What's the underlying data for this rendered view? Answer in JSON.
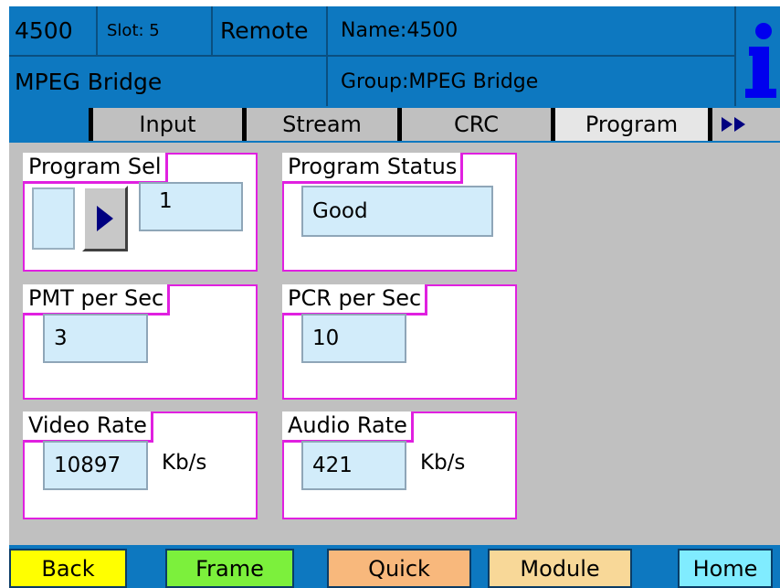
{
  "header": {
    "model": "4500",
    "slot": "Slot: 5",
    "mode": "Remote",
    "name": "Name:4500",
    "product": "MPEG Bridge",
    "group": "Group:MPEG Bridge",
    "info_icon": "info-icon"
  },
  "tabs": {
    "input": "Input",
    "stream": "Stream",
    "crc": "CRC",
    "program": "Program",
    "more_icon": "double-right-arrow-icon"
  },
  "panels": {
    "program_sel": {
      "title": "Program Sel",
      "value": "1"
    },
    "program_status": {
      "title": "Program Status",
      "value": "Good"
    },
    "pmt_per_sec": {
      "title": "PMT per Sec",
      "value": "3"
    },
    "pcr_per_sec": {
      "title": "PCR per Sec",
      "value": "10"
    },
    "video_rate": {
      "title": "Video Rate",
      "value": "10897",
      "unit": "Kb/s"
    },
    "audio_rate": {
      "title": "Audio Rate",
      "value": "421",
      "unit": "Kb/s"
    }
  },
  "nav": {
    "back": "Back",
    "frame": "Frame",
    "quick": "Quick",
    "module": "Module",
    "home": "Home"
  },
  "colors": {
    "header_blue": "#0d78c0",
    "panel_border": "#e020e0",
    "field_bg": "#d2ecfa",
    "back_btn": "#ffff00",
    "frame_btn": "#7cf03c",
    "quick_btn": "#f8b87c",
    "module_btn": "#f8d898",
    "home_btn": "#80ecff"
  }
}
